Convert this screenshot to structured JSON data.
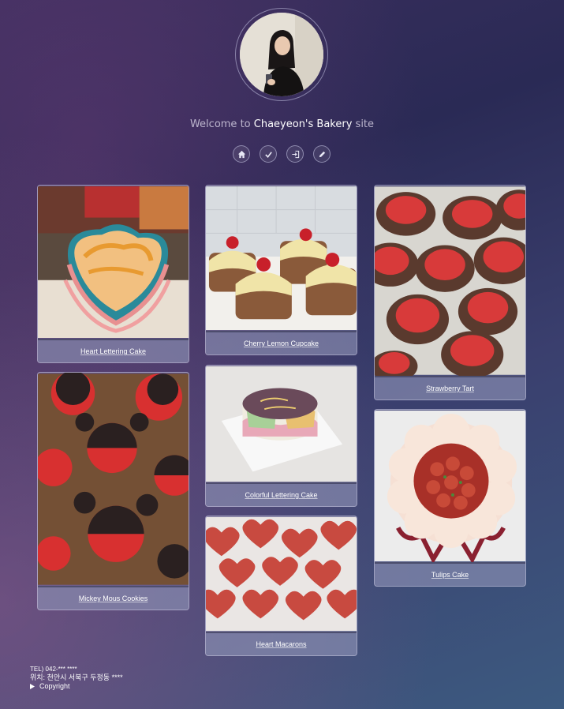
{
  "header": {
    "welcome_prefix": "Welcome to",
    "brand": "Chaeyeon's Bakery",
    "welcome_suffix": "site"
  },
  "nav": [
    {
      "name": "home-icon"
    },
    {
      "name": "check-icon"
    },
    {
      "name": "login-icon"
    },
    {
      "name": "edit-icon"
    }
  ],
  "cards": [
    {
      "label": "Heart Lettering Cake"
    },
    {
      "label": "Mickey Mous Cookies"
    },
    {
      "label": "Cherry Lemon Cupcake"
    },
    {
      "label": "Colorful Lettering Cake"
    },
    {
      "label": "Heart Macarons"
    },
    {
      "label": "Strawberry Tart"
    },
    {
      "label": "Tulips Cake"
    }
  ],
  "footer": {
    "tel": "TEL) 042-*** ****",
    "location": "위치: 천안시 서북구 두정동 ****",
    "copyright": "Copyright"
  }
}
